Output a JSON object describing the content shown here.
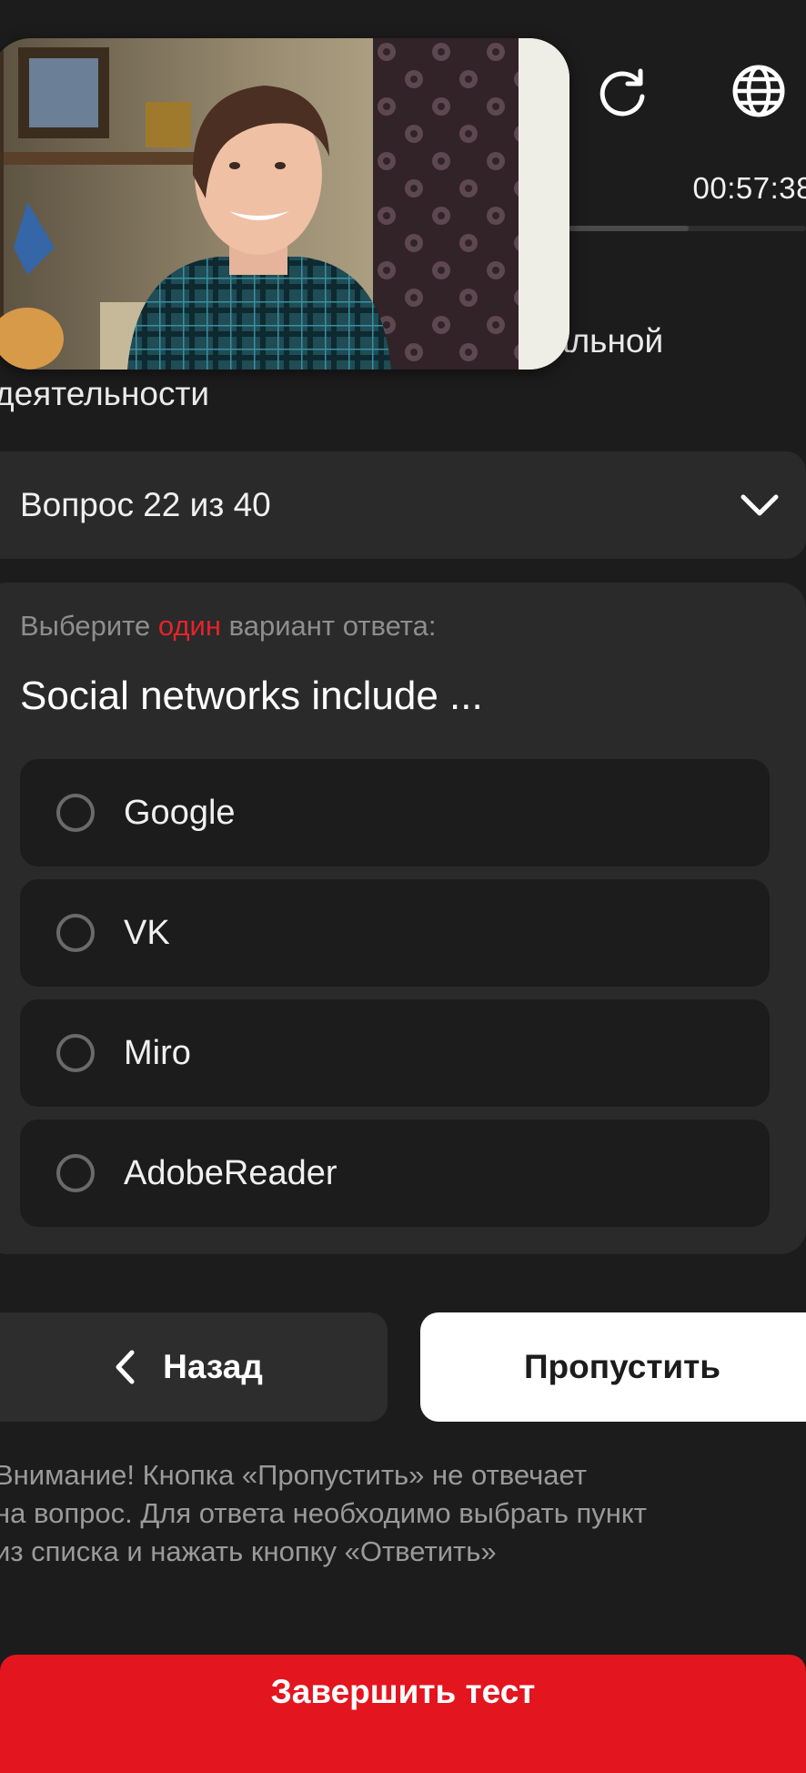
{
  "header": {
    "refresh_icon": "refresh-icon",
    "language_icon": "globe-icon",
    "timer": "00:57:38",
    "progress": 0.55
  },
  "section": {
    "title_line1": "альной",
    "title_line2": "деятельности"
  },
  "question_selector": {
    "label": "Вопрос 22 из 40",
    "icon": "chevron-down-icon"
  },
  "question": {
    "instruction_prefix": "Выберите",
    "instruction_accent": "один",
    "instruction_suffix": "вариант ответа:",
    "text": "Social networks include ...",
    "options": [
      {
        "label": "Google"
      },
      {
        "label": "VK"
      },
      {
        "label": "Miro"
      },
      {
        "label": "AdobeReader"
      }
    ]
  },
  "nav": {
    "back_label": "Назад",
    "skip_label": "Пропустить"
  },
  "notice": {
    "line1": "Внимание! Кнопка «Пропустить» не отвечает",
    "line2": "на вопрос. Для ответа необходимо выбрать пункт",
    "line3": "из списка и нажать кнопку «Ответить»"
  },
  "footer": {
    "finish_label": "Завершить тест"
  },
  "colors": {
    "accent": "#e3151f",
    "background": "#1c1c1c",
    "card": "#2a2a2a"
  }
}
